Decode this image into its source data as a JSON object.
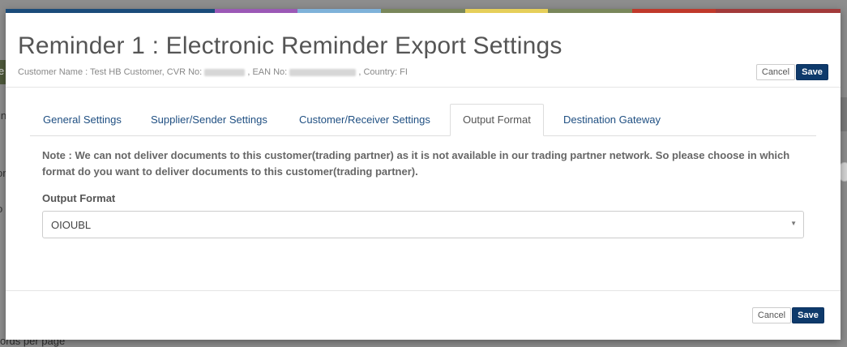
{
  "background": {
    "left_fragments": [
      "e",
      "in",
      "or",
      "o"
    ],
    "footer_fragment": "ords per page"
  },
  "modal": {
    "accent_colors": [
      "#1a4b7a",
      "#1a4b7a",
      "#9b59b6",
      "#7fb2d9",
      "#79875b",
      "#e6cf5a",
      "#79875b",
      "#c0392b",
      "#a23a3a"
    ],
    "title": "Reminder 1 :  Electronic Reminder Export Settings",
    "subtitle": {
      "customer_label": "Customer Name : Test HB Customer, CVR No:",
      "ean_label": ", EAN No:",
      "country_label": ", Country: FI"
    },
    "header_buttons": {
      "cancel": "Cancel",
      "save": "Save"
    },
    "tabs": [
      {
        "label": "General Settings",
        "active": false
      },
      {
        "label": "Supplier/Sender Settings",
        "active": false
      },
      {
        "label": "Customer/Receiver Settings",
        "active": false
      },
      {
        "label": "Output Format",
        "active": true
      },
      {
        "label": "Destination Gateway",
        "active": false
      }
    ],
    "note": "Note : We can not deliver documents to this customer(trading partner) as it is not available in our trading partner network. So please choose in which format do you want to deliver documents to this customer(trading partner).",
    "output_format": {
      "label": "Output Format",
      "selected": "OIOUBL"
    },
    "footer_buttons": {
      "cancel": "Cancel",
      "save": "Save"
    }
  }
}
